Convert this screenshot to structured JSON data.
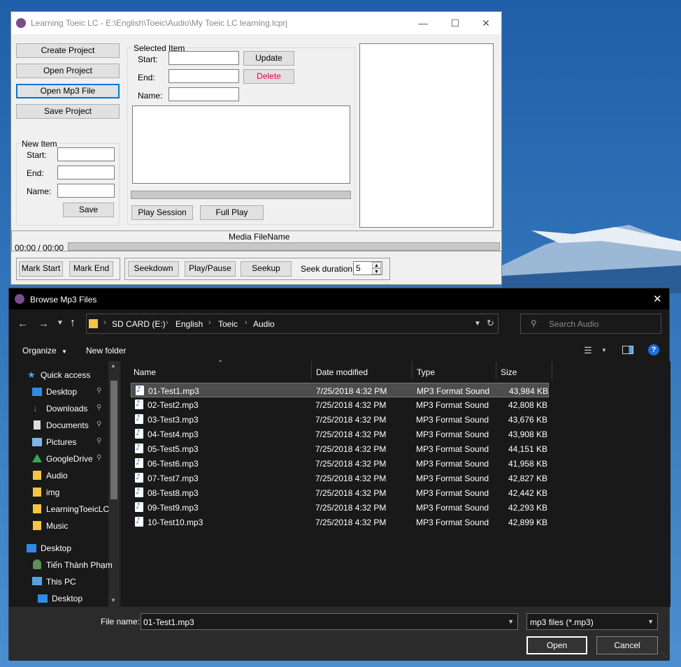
{
  "app": {
    "title": "Learning Toeic LC - E:\\English\\Toeic\\Audio\\My Toeic LC learning.lcprj",
    "left_buttons": [
      "Create Project",
      "Open Project",
      "Open Mp3 File",
      "Save Project"
    ],
    "new_item": {
      "group_title": "New Item",
      "start_label": "Start:",
      "end_label": "End:",
      "name_label": "Name:",
      "save_label": "Save"
    },
    "selected_item": {
      "group_title": "Selected Item",
      "start_label": "Start:",
      "end_label": "End:",
      "name_label": "Name:",
      "update_label": "Update",
      "delete_label": "Delete",
      "play_session_label": "Play Session",
      "full_play_label": "Full Play"
    },
    "media": {
      "filename_label": "Media FileName",
      "time": "00:00 / 00:00",
      "mark_start": "Mark Start",
      "mark_end": "Mark End",
      "seekdown": "Seekdown",
      "play_pause": "Play/Pause",
      "seekup": "Seekup",
      "seek_duration_label": "Seek duration:",
      "seek_duration_value": "5"
    }
  },
  "dialog": {
    "title": "Browse Mp3 Files",
    "breadcrumb": [
      "SD CARD (E:)",
      "English",
      "Toeic",
      "Audio"
    ],
    "search_placeholder": "Search Audio",
    "organize_label": "Organize",
    "new_folder_label": "New folder",
    "nav_items": [
      {
        "label": "Quick access",
        "icon": "star-icon"
      },
      {
        "label": "Desktop",
        "icon": "desktop-icon",
        "pinned": true
      },
      {
        "label": "Downloads",
        "icon": "download-icon",
        "pinned": true
      },
      {
        "label": "Documents",
        "icon": "documents-icon",
        "pinned": true
      },
      {
        "label": "Pictures",
        "icon": "pictures-icon",
        "pinned": true
      },
      {
        "label": "GoogleDrive",
        "icon": "google-drive-icon",
        "pinned": true
      },
      {
        "label": "Audio",
        "icon": "folder-icon"
      },
      {
        "label": "img",
        "icon": "folder-icon"
      },
      {
        "label": "LearningToeicLC",
        "icon": "folder-icon"
      },
      {
        "label": "Music",
        "icon": "folder-icon"
      },
      {
        "label": "Desktop",
        "icon": "desktop-icon"
      },
      {
        "label": "Tiến Thành Phạm",
        "icon": "user-icon"
      },
      {
        "label": "This PC",
        "icon": "computer-icon"
      },
      {
        "label": "Desktop",
        "icon": "desktop-icon"
      }
    ],
    "columns": [
      "Name",
      "Date modified",
      "Type",
      "Size"
    ],
    "files": [
      {
        "name": "01-Test1.mp3",
        "date": "7/25/2018 4:32 PM",
        "type": "MP3 Format Sound",
        "size": "43,984 KB",
        "selected": true
      },
      {
        "name": "02-Test2.mp3",
        "date": "7/25/2018 4:32 PM",
        "type": "MP3 Format Sound",
        "size": "42,808 KB"
      },
      {
        "name": "03-Test3.mp3",
        "date": "7/25/2018 4:32 PM",
        "type": "MP3 Format Sound",
        "size": "43,676 KB"
      },
      {
        "name": "04-Test4.mp3",
        "date": "7/25/2018 4:32 PM",
        "type": "MP3 Format Sound",
        "size": "43,908 KB"
      },
      {
        "name": "05-Test5.mp3",
        "date": "7/25/2018 4:32 PM",
        "type": "MP3 Format Sound",
        "size": "44,151 KB"
      },
      {
        "name": "06-Test6.mp3",
        "date": "7/25/2018 4:32 PM",
        "type": "MP3 Format Sound",
        "size": "41,958 KB"
      },
      {
        "name": "07-Test7.mp3",
        "date": "7/25/2018 4:32 PM",
        "type": "MP3 Format Sound",
        "size": "42,827 KB"
      },
      {
        "name": "08-Test8.mp3",
        "date": "7/25/2018 4:32 PM",
        "type": "MP3 Format Sound",
        "size": "42,442 KB"
      },
      {
        "name": "09-Test9.mp3",
        "date": "7/25/2018 4:32 PM",
        "type": "MP3 Format Sound",
        "size": "42,293 KB"
      },
      {
        "name": "10-Test10.mp3",
        "date": "7/25/2018 4:32 PM",
        "type": "MP3 Format Sound",
        "size": "42,899 KB"
      }
    ],
    "file_name_label": "File name:",
    "file_name_value": "01-Test1.mp3",
    "file_type_value": "mp3 files (*.mp3)",
    "open_label": "Open",
    "cancel_label": "Cancel"
  }
}
